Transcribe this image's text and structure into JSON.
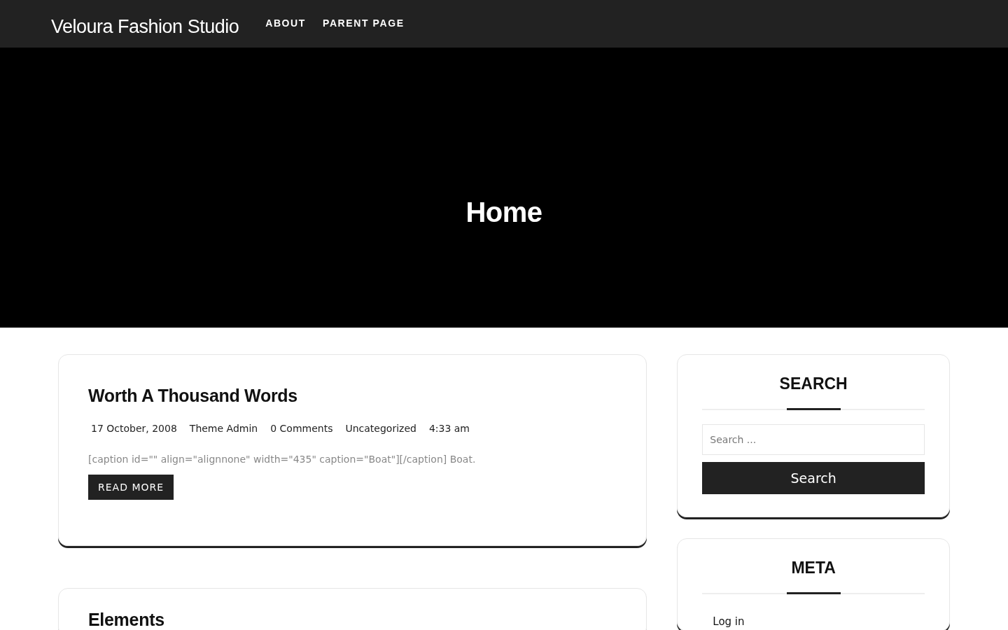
{
  "site_title": "Veloura Fashion Studio",
  "nav": [
    {
      "label": "ABOUT"
    },
    {
      "label": "PARENT PAGE"
    }
  ],
  "hero": {
    "title": "Home"
  },
  "posts": [
    {
      "title": "Worth A Thousand Words",
      "meta": [
        "17 October, 2008",
        "Theme Admin",
        "0 Comments",
        "Uncategorized",
        "4:33 am"
      ],
      "excerpt": "[caption id=\"\" align=\"alignnone\" width=\"435\" caption=\"Boat\"][/caption] Boat.",
      "button": "READ MORE"
    },
    {
      "title": "Elements"
    }
  ],
  "widgets": [
    {
      "kind": "search",
      "title": "SEARCH",
      "placeholder": "Search ...",
      "button": "Search"
    },
    {
      "kind": "links",
      "title": "META",
      "links": [
        "Log in"
      ]
    }
  ]
}
